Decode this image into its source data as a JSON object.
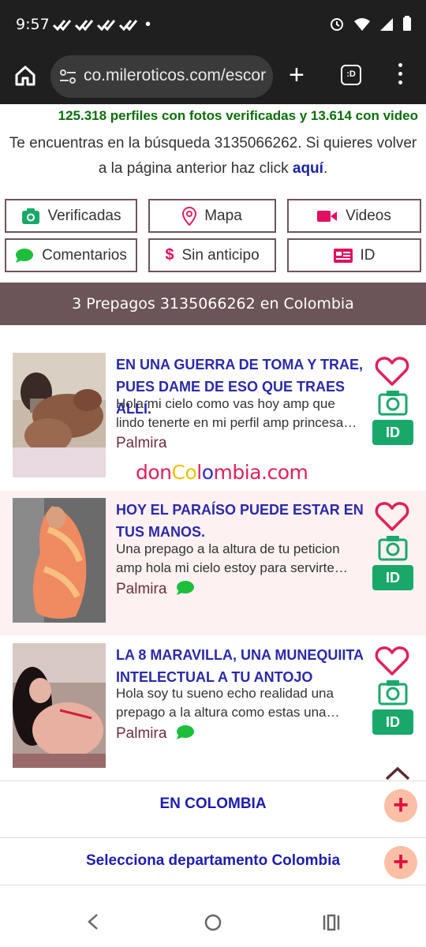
{
  "status_bar": {
    "time": "9:57",
    "check_icons": [
      "check-icon",
      "check-icon",
      "check-icon",
      "check-icon"
    ],
    "dot": "•"
  },
  "browser": {
    "url": "co.mileroticos.com/escor",
    "tabs_label": ":D"
  },
  "stats": "125.318 perfiles con fotos verificadas y 13.614 con video",
  "search_message": {
    "text": "Te encuentras en la búsqueda 3135066262. Si quieres volver a la página anterior haz click",
    "link": "aquí",
    "end": "."
  },
  "filters": [
    {
      "label": "Verificadas",
      "icon": "camera-icon",
      "color": "#1aa86a"
    },
    {
      "label": "Mapa",
      "icon": "map-pin-icon",
      "color": "#e0205a"
    },
    {
      "label": "Videos",
      "icon": "video-icon",
      "color": "#e01060"
    },
    {
      "label": "Comentarios",
      "icon": "chat-icon",
      "color": "#1dbf3a"
    },
    {
      "label": "Sin anticipo",
      "icon": "dollar-icon",
      "color": "#e01060"
    },
    {
      "label": "ID",
      "icon": "id-card-icon",
      "color": "#e01060"
    }
  ],
  "section_title": "3 Prepagos 3135066262 en Colombia",
  "listings": [
    {
      "title": "EN UNA GUERRA DE TOMA Y TRAE, PUES DAME DE ESO QUE TRAES ALLÍ.",
      "description": "Hola mi cielo como vas hoy amp que lindo tenerte en mi perfil amp princesa…",
      "city": "Palmira",
      "has_comments": false,
      "id_label": "ID"
    },
    {
      "title": "HOY EL PARAÍSO PUEDE ESTAR EN TUS MANOS.",
      "description": "Una prepago a la altura de tu peticion amp hola mi cielo estoy para servirte…",
      "city": "Palmira",
      "has_comments": true,
      "id_label": "ID"
    },
    {
      "title": "LA 8 MARAVILLA, UNA MUNEQUIITA INTELECTUAL A TU ANTOJO",
      "description": "Hola soy tu sueno echo realidad una prepago a la altura como estas una…",
      "city": "Palmira",
      "has_comments": true,
      "id_label": "ID"
    }
  ],
  "watermark": {
    "parts": [
      "don",
      "Co",
      "l",
      "o",
      "m",
      "bia.com"
    ],
    "colors": [
      "#e0205a",
      "#f2c200",
      "#e0205a",
      "#2a2ad0",
      "#e0205a",
      "#e0205a"
    ]
  },
  "accordion": [
    {
      "label": "EN COLOMBIA",
      "button": "+"
    },
    {
      "label": "Selecciona departamento Colombia",
      "button": "+"
    }
  ]
}
